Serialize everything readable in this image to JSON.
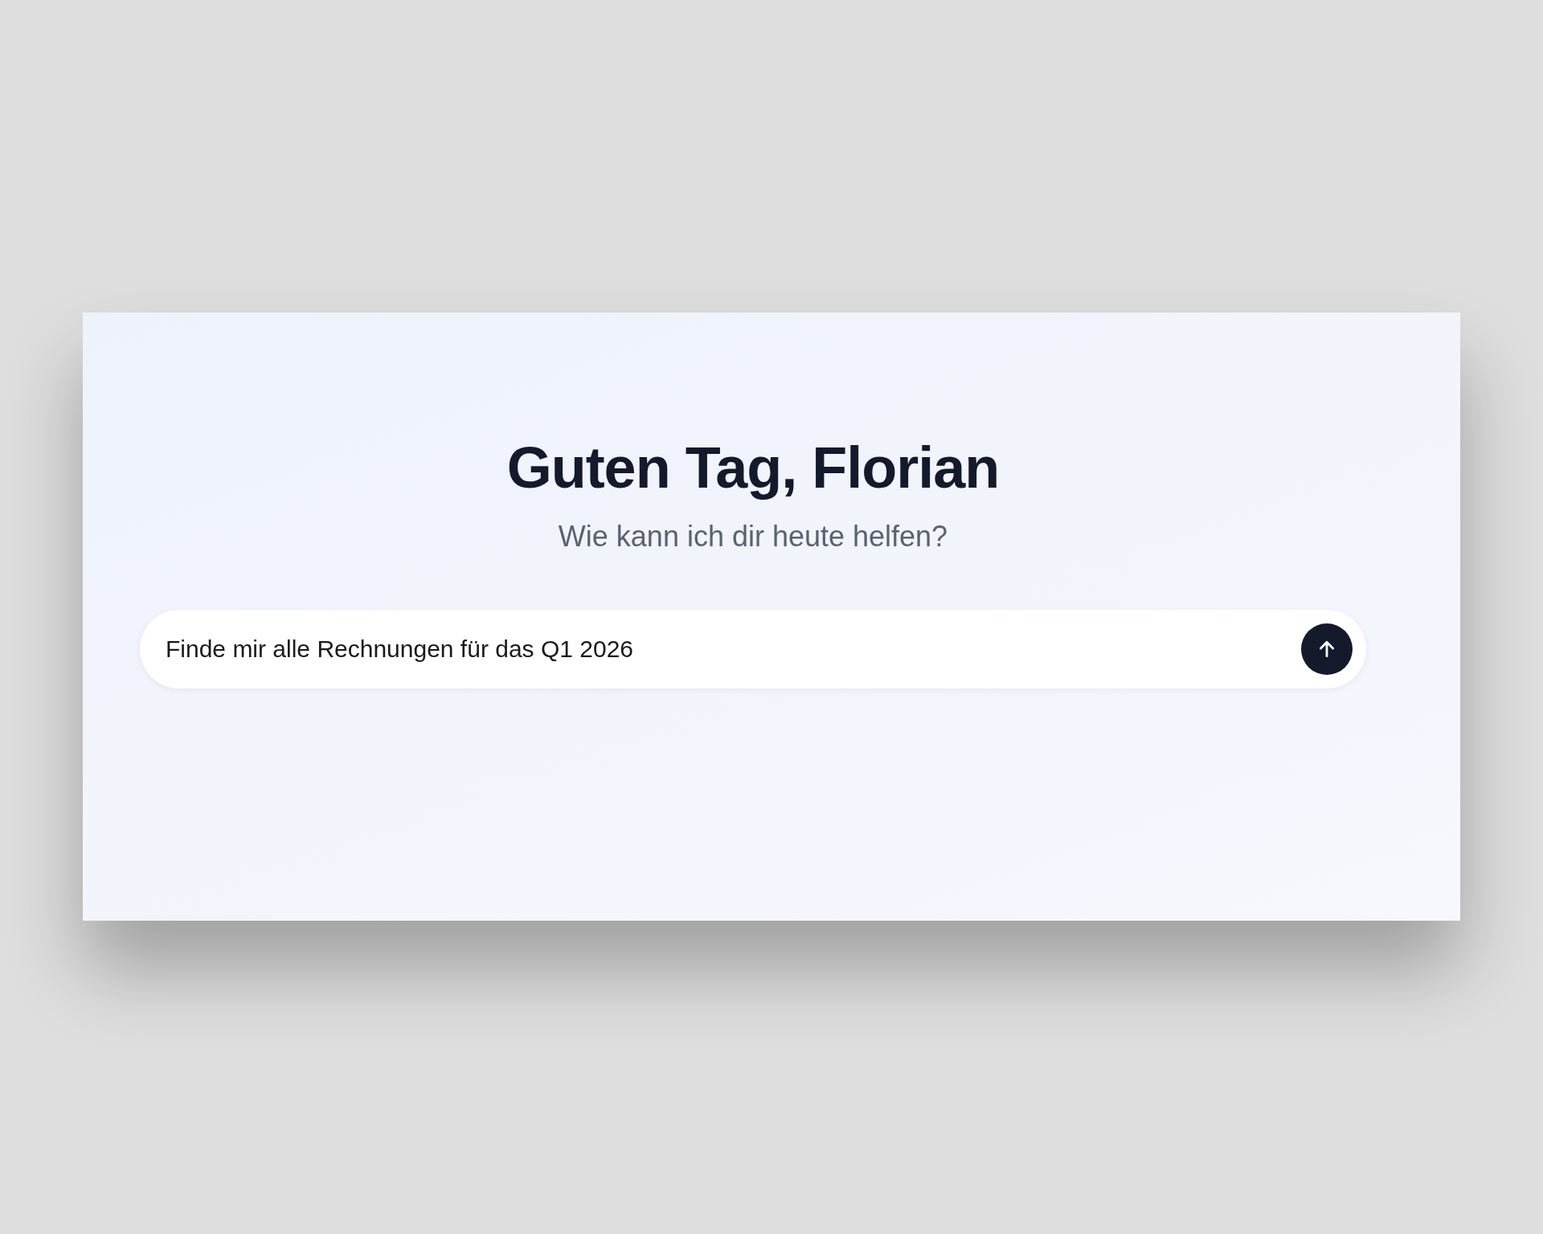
{
  "greeting": {
    "title": "Guten Tag, Florian",
    "subtitle": "Wie kann ich dir heute helfen?"
  },
  "prompt": {
    "value": "Finde mir alle Rechnungen für das Q1 2026"
  }
}
